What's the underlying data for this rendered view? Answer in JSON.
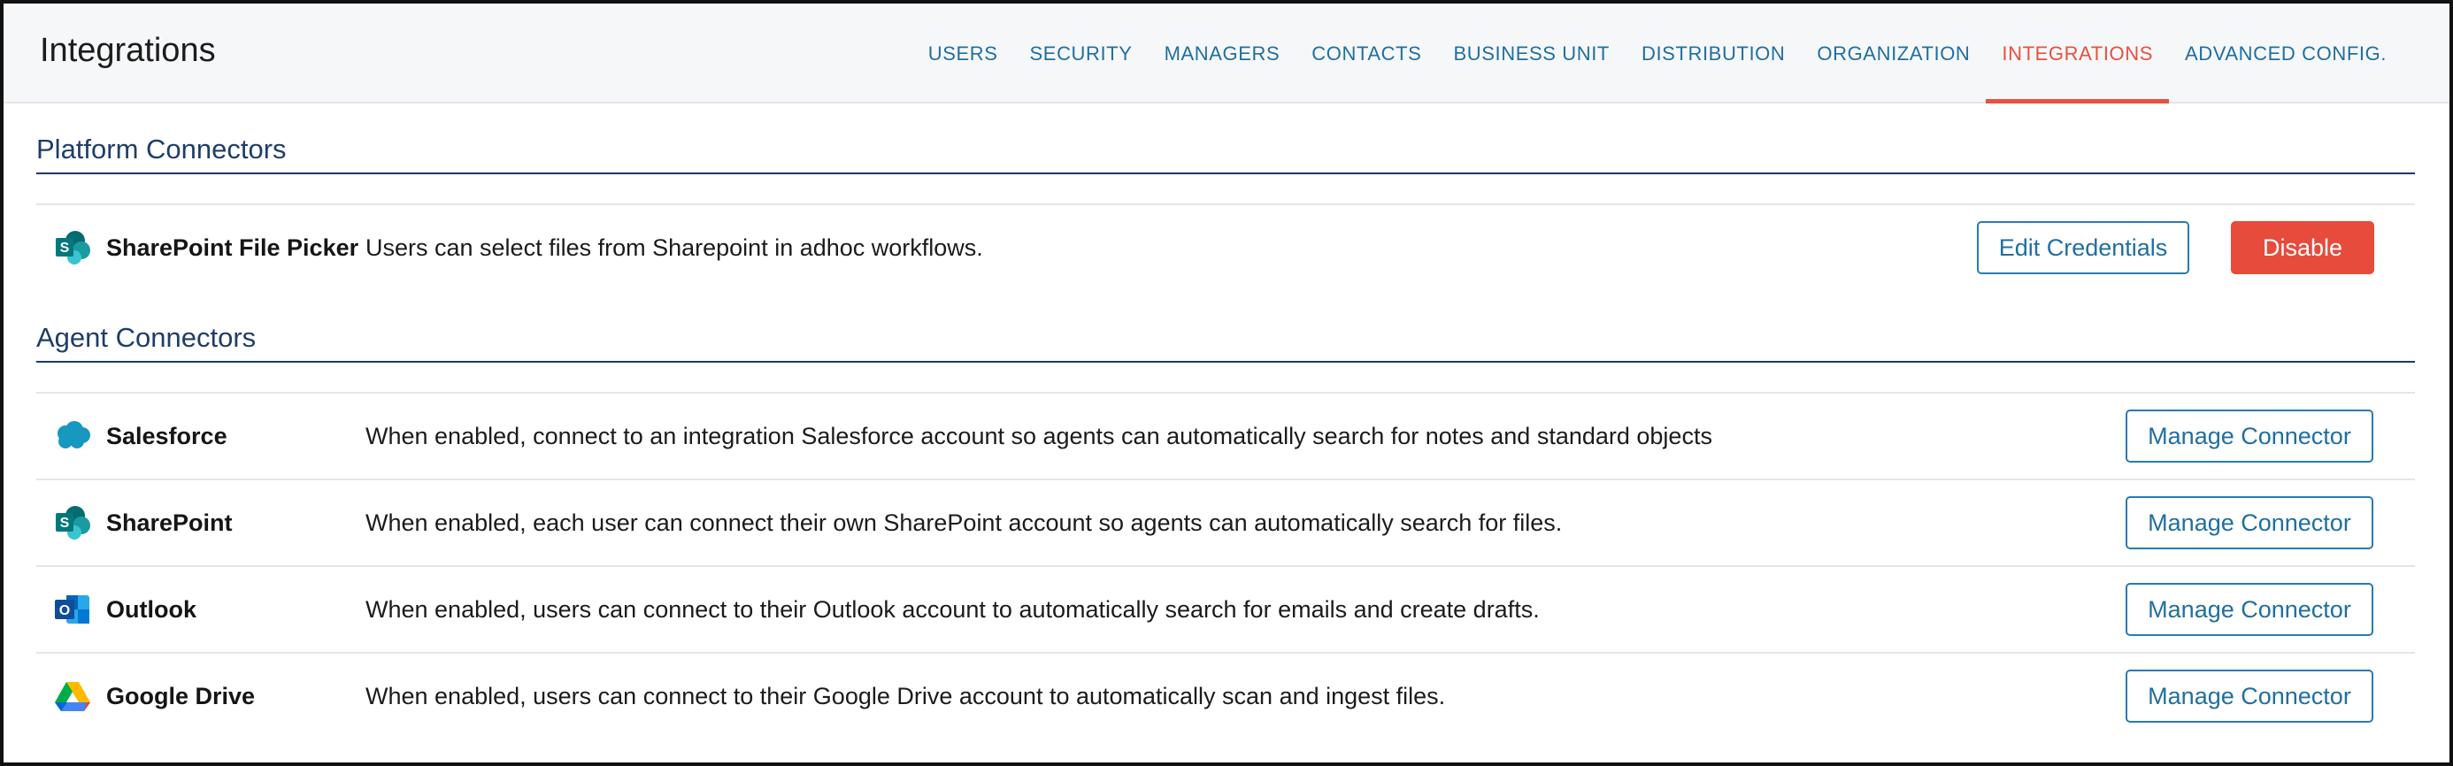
{
  "header": {
    "title": "Integrations",
    "tabs": [
      {
        "label": "USERS"
      },
      {
        "label": "SECURITY"
      },
      {
        "label": "MANAGERS"
      },
      {
        "label": "CONTACTS"
      },
      {
        "label": "BUSINESS UNIT"
      },
      {
        "label": "DISTRIBUTION"
      },
      {
        "label": "ORGANIZATION"
      },
      {
        "label": "INTEGRATIONS",
        "active": true
      },
      {
        "label": "ADVANCED CONFIG."
      }
    ]
  },
  "platform": {
    "title": "Platform Connectors",
    "rows": [
      {
        "icon": "sharepoint-icon",
        "name": "SharePoint File Picker",
        "description": "Users can select files from Sharepoint in adhoc workflows.",
        "edit_label": "Edit Credentials",
        "disable_label": "Disable"
      }
    ]
  },
  "agent": {
    "title": "Agent Connectors",
    "rows": [
      {
        "icon": "salesforce-icon",
        "name": "Salesforce",
        "description": "When enabled, connect to an integration Salesforce account so agents can automatically search for notes and standard objects",
        "button_label": "Manage Connector"
      },
      {
        "icon": "sharepoint-icon",
        "name": "SharePoint",
        "description": "When enabled, each user can connect their own SharePoint account so agents can automatically search for files.",
        "button_label": "Manage Connector"
      },
      {
        "icon": "outlook-icon",
        "name": "Outlook",
        "description": "When enabled, users can connect to their Outlook account to automatically search for emails and create drafts.",
        "button_label": "Manage Connector"
      },
      {
        "icon": "google-drive-icon",
        "name": "Google Drive",
        "description": "When enabled, users can connect to their Google Drive account to automatically scan and ingest files.",
        "button_label": "Manage Connector"
      }
    ]
  },
  "colors": {
    "accent": "#1f6fa0",
    "active_tab": "#e8513f",
    "danger": "#e64b3c",
    "section_title": "#1f3e67",
    "section_rule": "#1b3a6b"
  }
}
